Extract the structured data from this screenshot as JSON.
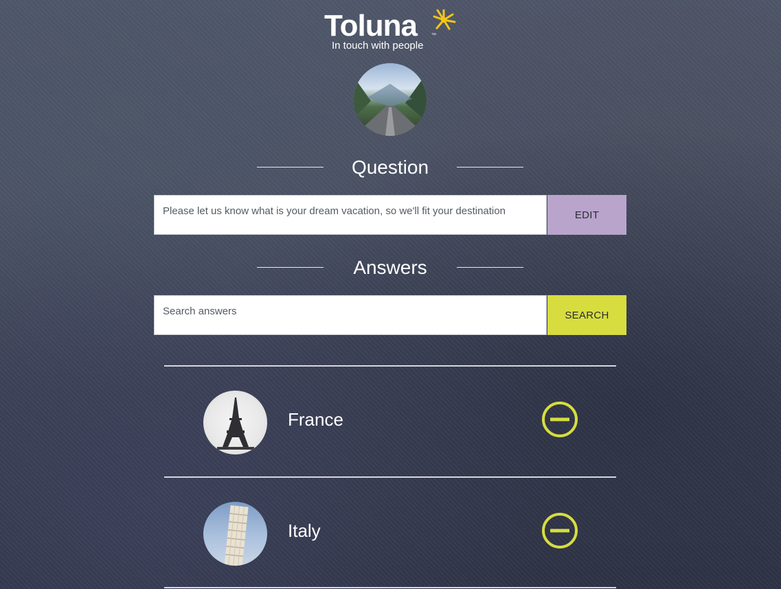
{
  "brand": {
    "name": "Toluna",
    "tagline": "In touch with people",
    "accent_color": "#d7dd3f",
    "star_color": "#f5c518"
  },
  "question_section": {
    "heading": "Question",
    "value": "Please let us know what is your dream vacation, so we'll fit your destination",
    "edit_label": "EDIT",
    "edit_color": "#b9a4cc"
  },
  "answers_section": {
    "heading": "Answers",
    "search_placeholder": "Search answers",
    "search_label": "SEARCH",
    "search_color": "#d7dd3f"
  },
  "answers": [
    {
      "label": "France",
      "image": "eiffel-tower-photo",
      "remove_icon": "minus-circle-icon"
    },
    {
      "label": "Italy",
      "image": "leaning-tower-of-pisa-photo",
      "remove_icon": "minus-circle-icon"
    }
  ]
}
